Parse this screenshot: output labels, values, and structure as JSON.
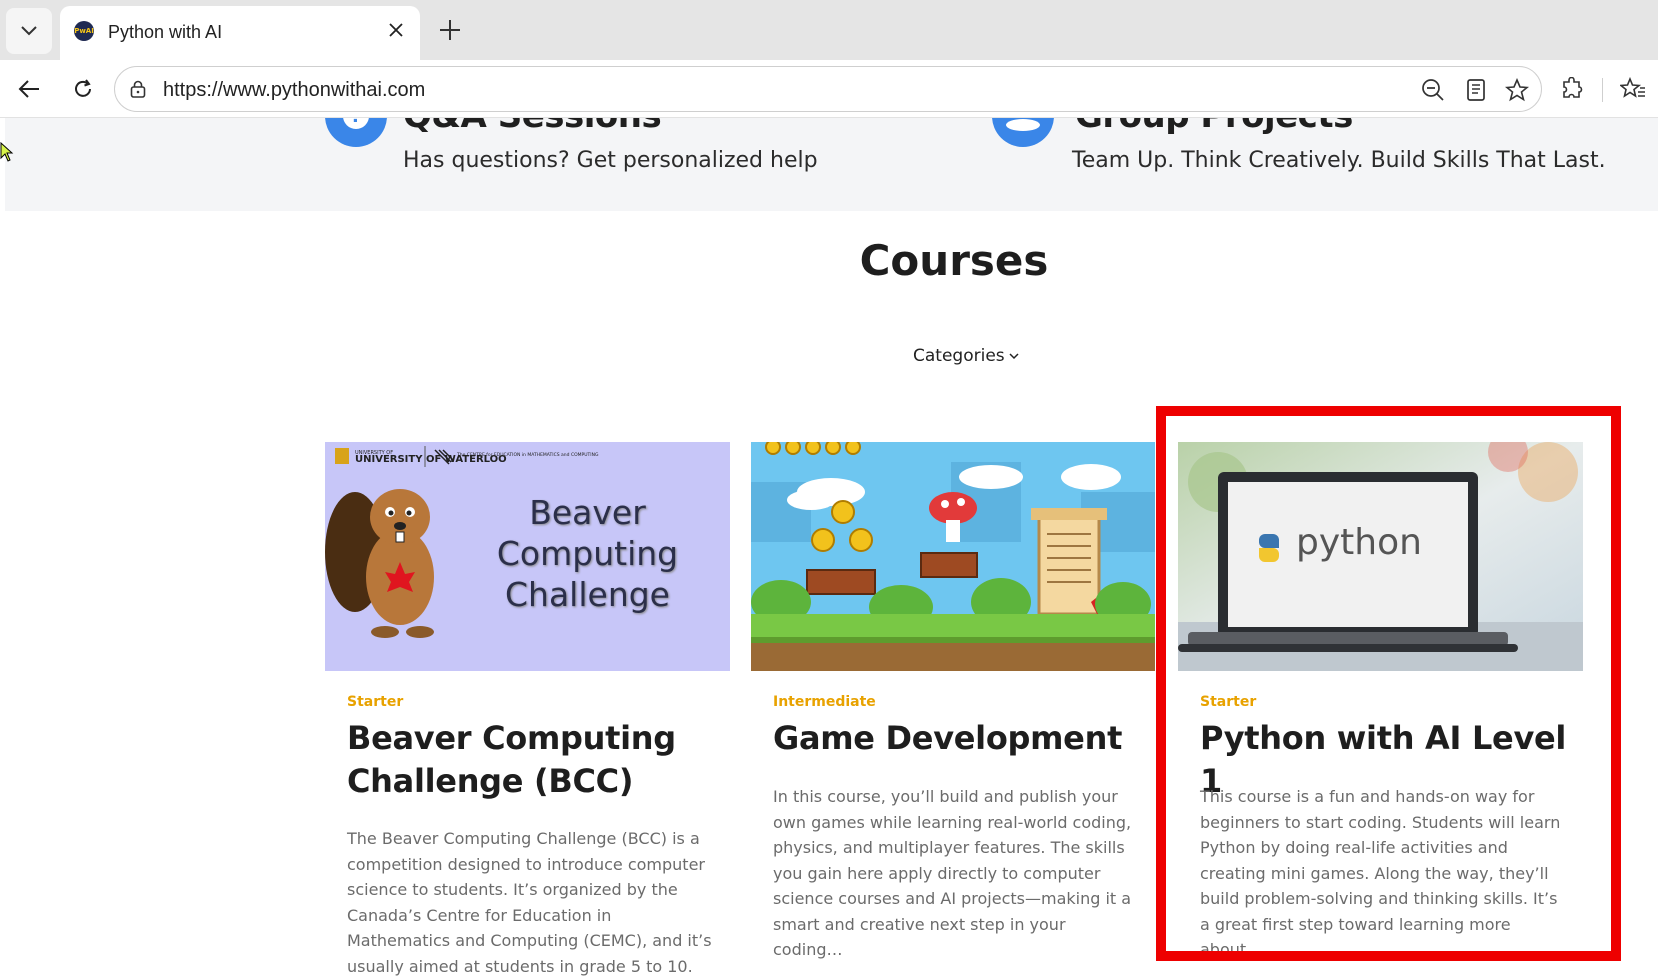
{
  "browser": {
    "tab": {
      "title": "Python with AI",
      "favicon_text": "PwAI"
    },
    "address": {
      "url": "https://www.pythonwithai.com"
    },
    "icons": [
      "tab-list-icon",
      "close-icon",
      "plus-icon",
      "back-icon",
      "reload-icon",
      "lock-icon",
      "zoom-out-icon",
      "reader-icon",
      "star-icon",
      "extensions-icon",
      "favorites-icon"
    ]
  },
  "features": [
    {
      "title": "Q&A Sessions",
      "description": "Has questions? Get personalized help",
      "icon": "question-icon"
    },
    {
      "title": "Group Projects",
      "description": "Team Up. Think Creatively. Build Skills That Last.",
      "icon": "group-icon"
    }
  ],
  "courses_section": {
    "heading": "Courses",
    "categories_label": "Categories",
    "cards": [
      {
        "level": "Starter",
        "title": "Beaver Computing Challenge (BCC)",
        "description": "The Beaver Computing Challenge (BCC) is a competition designed to introduce computer science to students. It’s organized by the Canada’s Centre for Education in Mathematics and Computing (CEMC), and it’s usually aimed at students in grade 5 to 10.",
        "image": {
          "type": "beaver-banner",
          "banner_text": "Beaver Computing Challenge",
          "logo_text_1": "UNIVERSITY OF WATERLOO",
          "logo_text_2": "The CENTRE for EDUCATION in MATHEMATICS and COMPUTING"
        }
      },
      {
        "level": "Intermediate",
        "title": "Game Development",
        "description": "In this course, you’ll build and publish your own games while learning real-world coding, physics, and multiplayer features. The skills you gain here apply directly to computer science courses and AI projects—making it a smart and creative next step in your coding…",
        "image": {
          "type": "pixel-game-scene"
        }
      },
      {
        "level": "Starter",
        "title": "Python with AI Level 1",
        "description": "This course is a fun and hands-on way for beginners to start coding. Students will learn Python by doing real-life activities and creating mini games. Along the way, they’ll build problem-solving and thinking skills. It’s a great first step toward learning more about…",
        "image": {
          "type": "laptop-python",
          "screen_text": "python"
        }
      }
    ]
  },
  "colors": {
    "accent_blue": "#3a86e8",
    "level_orange": "#e8a200",
    "highlight_red": "#ee0000"
  }
}
